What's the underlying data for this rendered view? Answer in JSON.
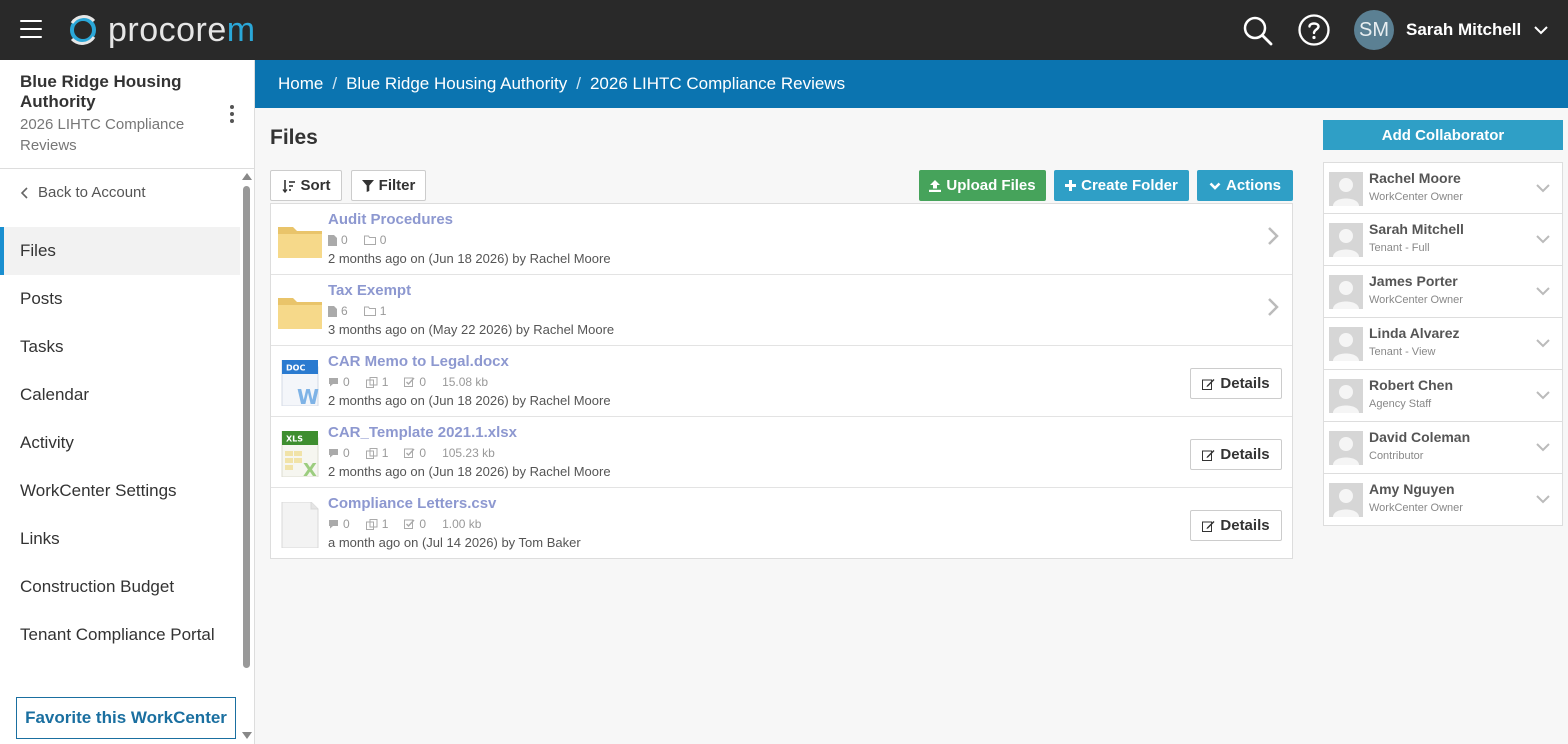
{
  "topbar": {
    "logo_main": "procore",
    "logo_accent": "m",
    "user_initials": "SM",
    "user_name": "Sarah Mitchell"
  },
  "sidebar": {
    "company": "Blue Ridge Housing Authority",
    "project": "2026 LIHTC Compliance Reviews",
    "back_label": "Back to Account",
    "items": [
      {
        "label": "Files",
        "active": true
      },
      {
        "label": "Posts"
      },
      {
        "label": "Tasks"
      },
      {
        "label": "Calendar"
      },
      {
        "label": "Activity"
      },
      {
        "label": "WorkCenter Settings"
      },
      {
        "label": "Links"
      },
      {
        "label": "Construction Budget"
      },
      {
        "label": "Tenant Compliance Portal"
      }
    ],
    "favorite_label": "Favorite this WorkCenter"
  },
  "breadcrumb": [
    "Home",
    "Blue Ridge Housing Authority",
    "2026 LIHTC Compliance Reviews"
  ],
  "breadcrumb_sep": "/",
  "main": {
    "title": "Files",
    "sort_label": "Sort",
    "filter_label": "Filter",
    "upload_label": "Upload Files",
    "create_folder_label": "Create Folder",
    "actions_label": "Actions",
    "details_label": "Details",
    "files": [
      {
        "kind": "folder",
        "name": "Audit Procedures",
        "files": "0",
        "folders": "0",
        "date": "2 months ago on (Jun 18 2026) by Rachel Moore"
      },
      {
        "kind": "folder",
        "name": "Tax Exempt",
        "files": "6",
        "folders": "1",
        "date": "3 months ago on (May 22 2026) by Rachel Moore"
      },
      {
        "kind": "doc",
        "name": "CAR Memo to Legal.docx",
        "comments": "0",
        "versions": "1",
        "tasks": "0",
        "size": "15.08 kb",
        "date": "2 months ago on (Jun 18 2026) by Rachel Moore"
      },
      {
        "kind": "xls",
        "name": "CAR_Template 2021.1.xlsx",
        "comments": "0",
        "versions": "1",
        "tasks": "0",
        "size": "105.23 kb",
        "date": "2 months ago on (Jun 18 2026) by Rachel Moore"
      },
      {
        "kind": "blank",
        "name": "Compliance Letters.csv",
        "comments": "0",
        "versions": "1",
        "tasks": "0",
        "size": "1.00 kb",
        "date": "a month ago on (Jul 14 2026) by Tom Baker"
      }
    ],
    "doc_badge": "DOC",
    "xls_badge": "XLS"
  },
  "collaborators": {
    "add_label": "Add Collaborator",
    "list": [
      {
        "name": "Rachel Moore",
        "role": "WorkCenter Owner"
      },
      {
        "name": "Sarah Mitchell",
        "role": "Tenant - Full"
      },
      {
        "name": "James Porter",
        "role": "WorkCenter Owner"
      },
      {
        "name": "Linda Alvarez",
        "role": "Tenant - View"
      },
      {
        "name": "Robert Chen",
        "role": "Agency Staff"
      },
      {
        "name": "David Coleman",
        "role": "Contributor"
      },
      {
        "name": "Amy Nguyen",
        "role": "WorkCenter Owner"
      }
    ]
  },
  "colors": {
    "topbar": "#292929",
    "breadcrumb_bar": "#0b74b0",
    "link": "#8d98d0",
    "green": "#46a35b",
    "teal": "#2f9fc6"
  }
}
